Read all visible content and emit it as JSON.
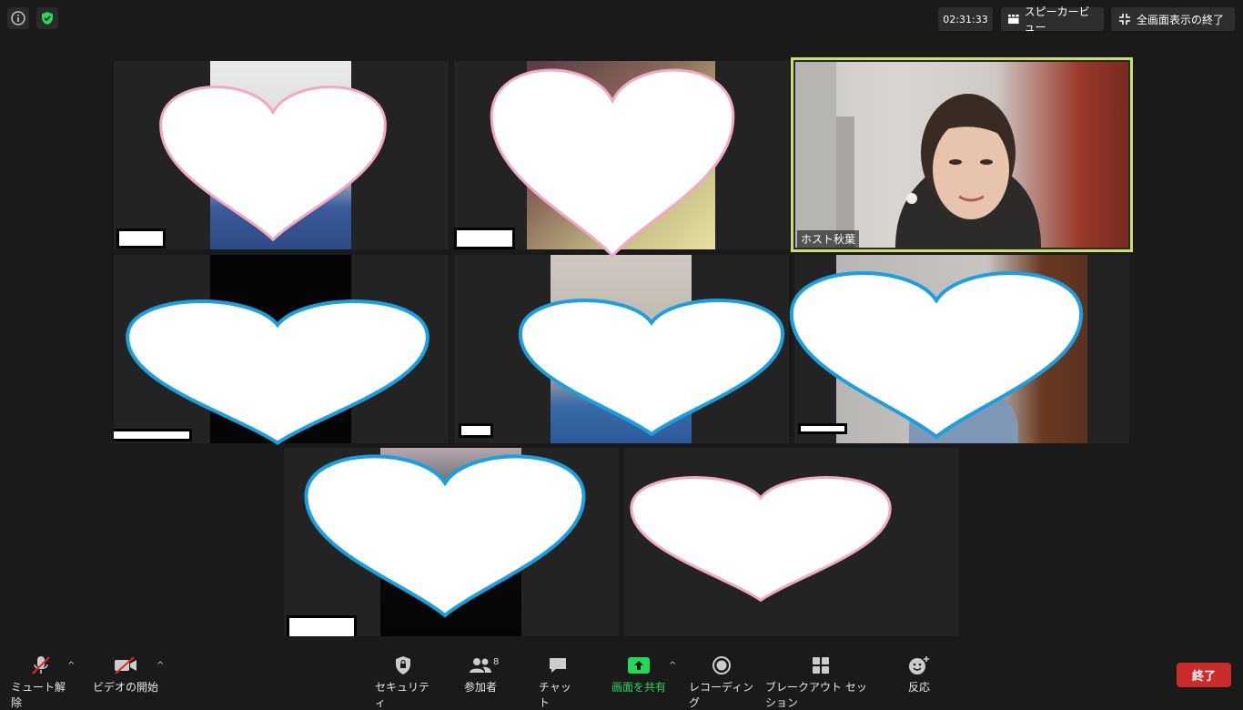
{
  "top": {
    "timer": "02:31:33",
    "speaker_view": "スピーカービュー",
    "exit_fullscreen": "全画面表示の終了"
  },
  "tiles": {
    "host_name": "ホスト秋葉"
  },
  "toolbar": {
    "unmute": "ミュート解除",
    "start_video": "ビデオの開始",
    "security": "セキュリティ",
    "participants": "参加者",
    "participants_count": "8",
    "chat": "チャット",
    "share_screen": "画面を共有",
    "recording": "レコーディング",
    "breakout": "ブレークアウト セッション",
    "reactions": "反応",
    "end": "終了"
  },
  "colors": {
    "active_speaker_border": "#c8e06a",
    "share_green": "#23d959",
    "end_red": "#cc2b2b",
    "heart_pink": "#f4a7c0",
    "heart_blue": "#1a9fe0"
  }
}
